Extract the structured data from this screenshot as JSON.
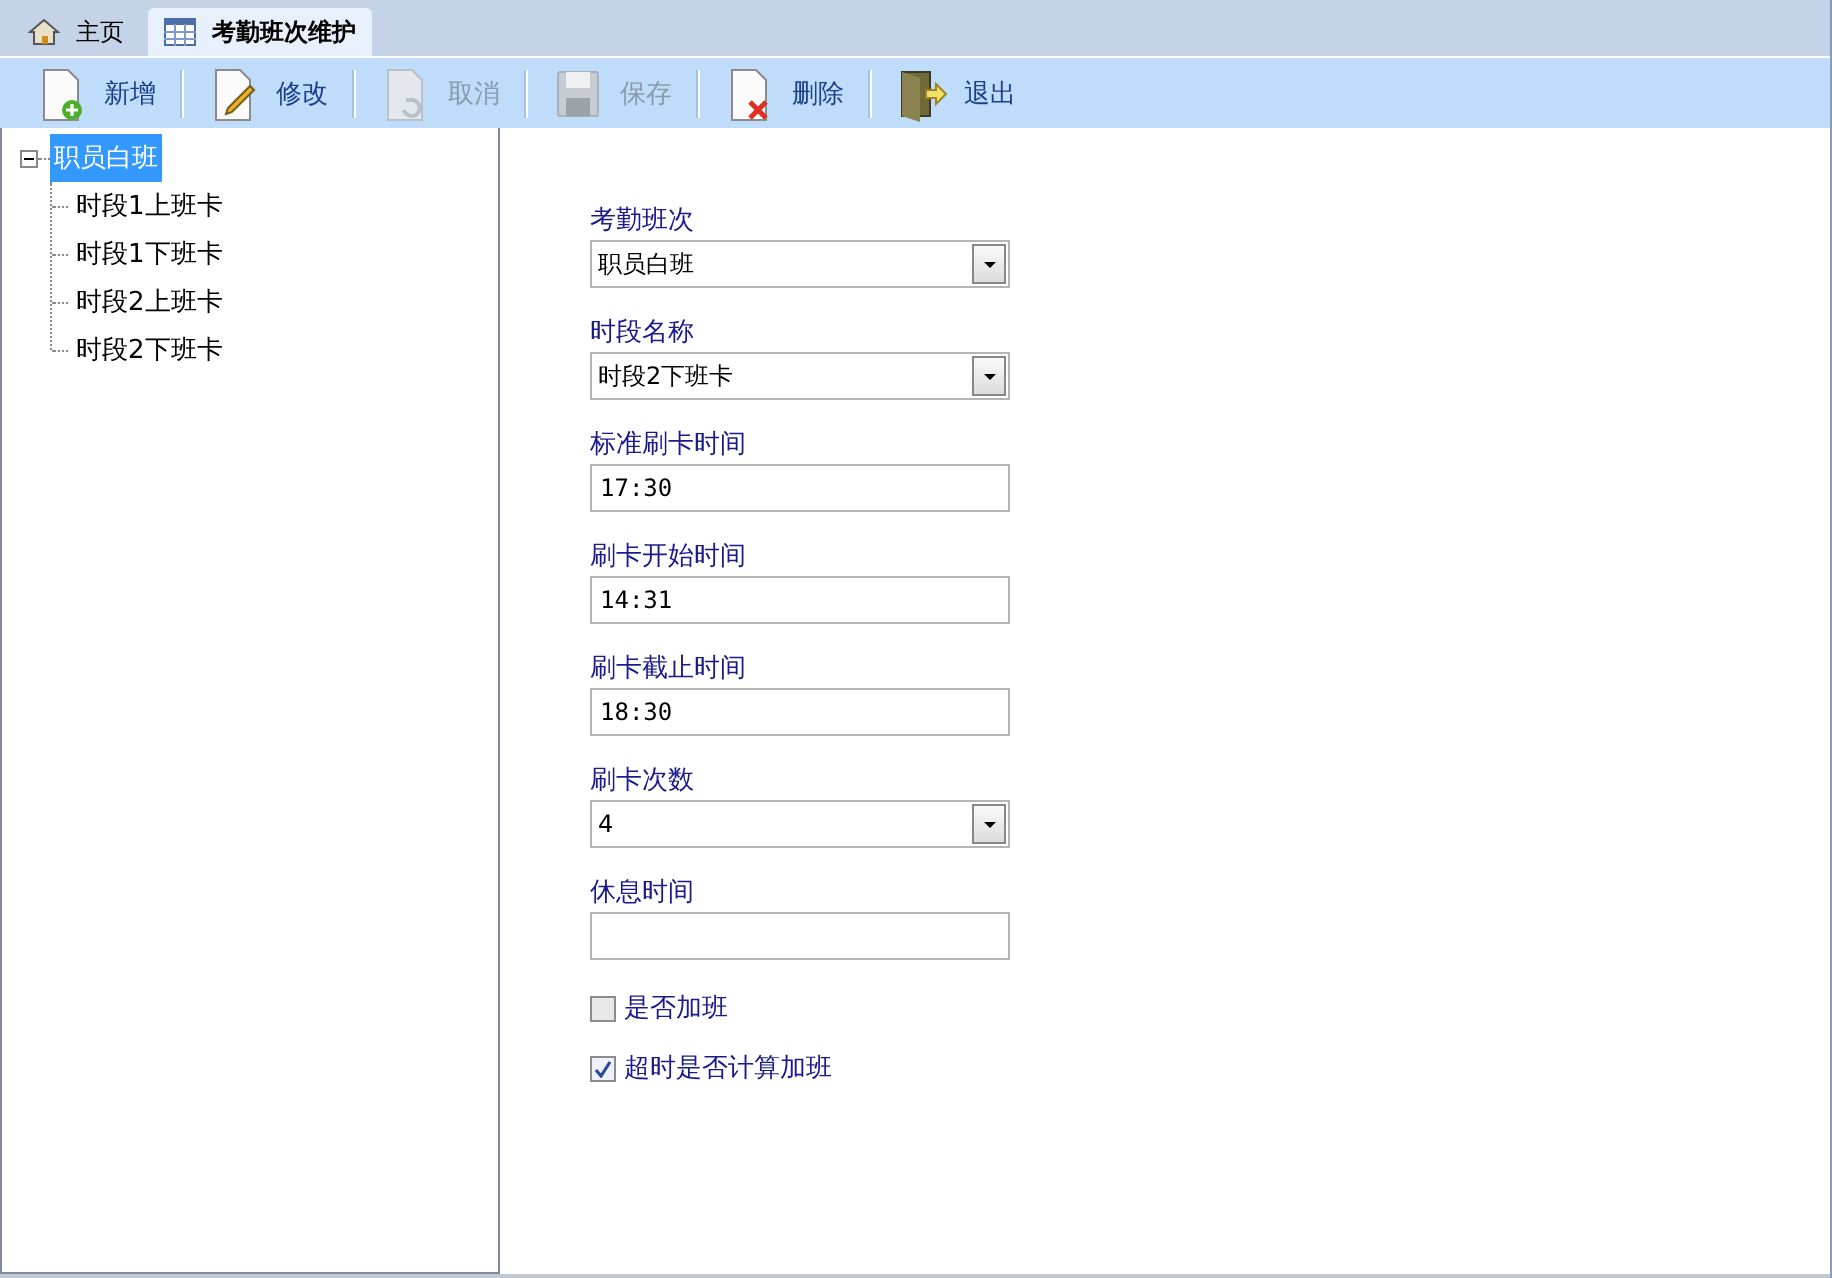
{
  "tabs": [
    {
      "label": "主页",
      "kind": "home",
      "selected": false
    },
    {
      "label": "考勤班次维护",
      "kind": "table",
      "selected": true
    }
  ],
  "toolbar": [
    {
      "label": "新增",
      "kind": "new",
      "disabled": false
    },
    {
      "label": "修改",
      "kind": "edit",
      "disabled": false
    },
    {
      "label": "取消",
      "kind": "undo",
      "disabled": true
    },
    {
      "label": "保存",
      "kind": "save",
      "disabled": true
    },
    {
      "label": "删除",
      "kind": "delete",
      "disabled": false
    },
    {
      "label": "退出",
      "kind": "exit",
      "disabled": false
    }
  ],
  "tree": [
    {
      "label": "职员白班",
      "expanded": true,
      "selected": true,
      "children": [
        {
          "label": "时段1上班卡",
          "selected": false
        },
        {
          "label": "时段1下班卡",
          "selected": false
        },
        {
          "label": "时段2上班卡",
          "selected": false
        },
        {
          "label": "时段2下班卡",
          "selected": false
        }
      ]
    }
  ],
  "form": [
    {
      "kind": "select",
      "label": "考勤班次",
      "value": "职员白班"
    },
    {
      "kind": "select",
      "label": "时段名称",
      "value": "时段2下班卡"
    },
    {
      "kind": "text",
      "label": "标准刷卡时间",
      "value": "17:30"
    },
    {
      "kind": "text",
      "label": "刷卡开始时间",
      "value": "14:31"
    },
    {
      "kind": "text",
      "label": "刷卡截止时间",
      "value": "18:30"
    },
    {
      "kind": "select",
      "label": "刷卡次数",
      "value": "4"
    },
    {
      "kind": "text",
      "label": "休息时间"
    },
    {
      "kind": "checkbox",
      "label": "是否加班",
      "checked": false
    },
    {
      "kind": "checkbox",
      "label": "超时是否计算加班",
      "checked": true
    }
  ]
}
